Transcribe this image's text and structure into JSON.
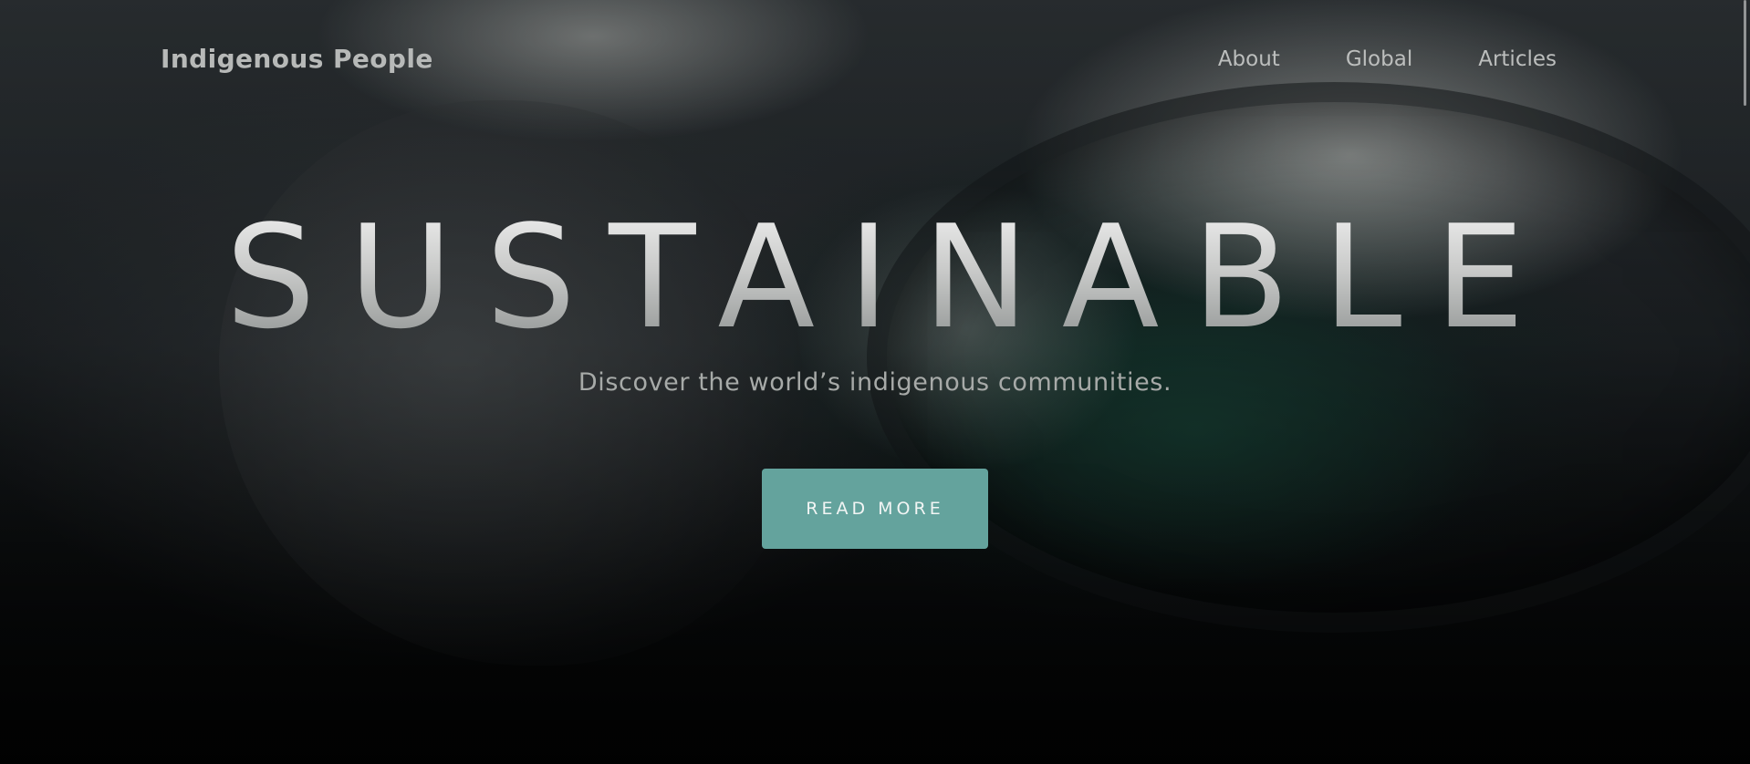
{
  "header": {
    "logo": "Indigenous People",
    "nav": [
      {
        "label": "About"
      },
      {
        "label": "Global"
      },
      {
        "label": "Articles"
      }
    ]
  },
  "hero": {
    "headline": "SUSTAINABLE",
    "tagline": "Discover the world’s indigenous communities.",
    "cta_label": "READ MORE"
  },
  "colors": {
    "accent": "#64a39d",
    "nav_text": "#bcbebd",
    "background": "#050607"
  }
}
